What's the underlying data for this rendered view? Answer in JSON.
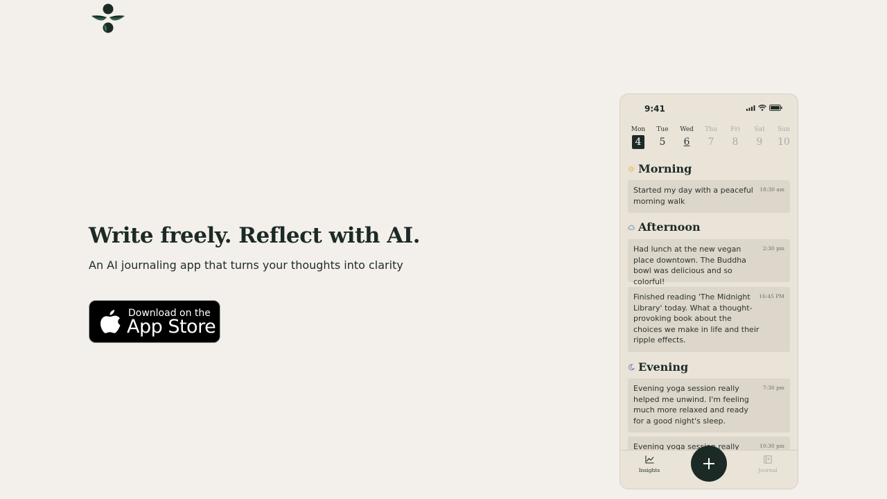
{
  "hero": {
    "title": "Write freely. Reflect with AI.",
    "subtitle": "An AI journaling app that turns your thoughts into clarity"
  },
  "app_store_button": {
    "small_text": "Download on the",
    "big_text": "App Store"
  },
  "phone": {
    "status_time": "9:41",
    "days": [
      {
        "name": "Mon",
        "num": "4",
        "state": "selected"
      },
      {
        "name": "Tue",
        "num": "5",
        "state": "normal"
      },
      {
        "name": "Wed",
        "num": "6",
        "state": "marked"
      },
      {
        "name": "Thu",
        "num": "7",
        "state": "muted"
      },
      {
        "name": "Fri",
        "num": "8",
        "state": "muted"
      },
      {
        "name": "Sat",
        "num": "9",
        "state": "muted"
      },
      {
        "name": "Sun",
        "num": "10",
        "state": "muted"
      }
    ],
    "sections": {
      "morning": "Morning",
      "afternoon": "Afternoon",
      "evening": "Evening"
    },
    "entries": [
      {
        "text": "Started my day with a peaceful morning walk",
        "time": "18:30 am"
      },
      {
        "text": "Had lunch at the new vegan place downtown. The Buddha bowl was delicious and so colorful!",
        "time": "2:30 pm"
      },
      {
        "text": "Finished reading 'The Midnight Library' today. What a thought-provoking book about the choices we make  in life and their ripple effects.",
        "time": "16:45 PM"
      },
      {
        "text": "Evening yoga session really helped me unwind. I'm feeling much more relaxed and ready for a good night's sleep.",
        "time": "7:30 pm"
      },
      {
        "text": "Evening yoga session really",
        "time": "10:30 pm"
      }
    ],
    "tabs": {
      "insights": "Insights",
      "journal": "Journal"
    }
  },
  "colors": {
    "background": "#f3f0eb",
    "ink": "#1c2a26",
    "phone_bg": "#e9e3d8",
    "card_bg": "#ddd6ca",
    "sun": "#e6b84a",
    "cloud": "#6f8fb8",
    "moon": "#6a6fc0"
  }
}
